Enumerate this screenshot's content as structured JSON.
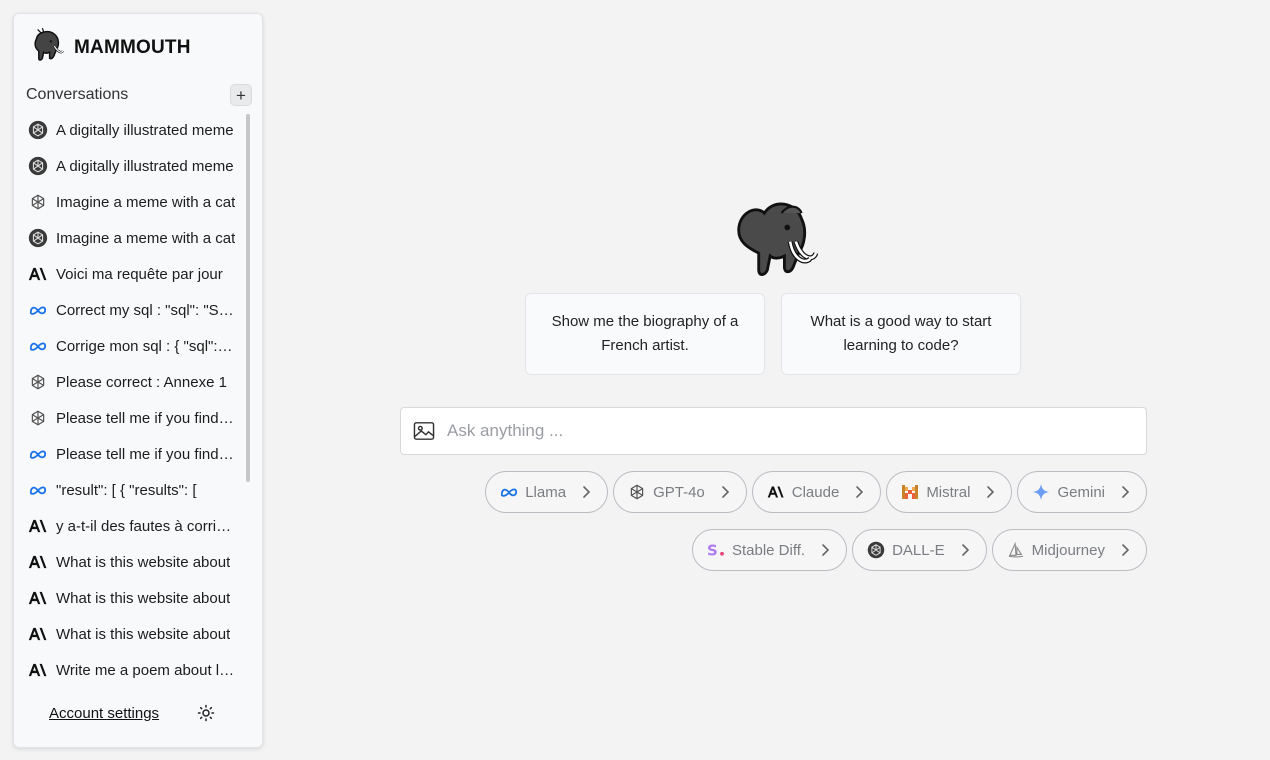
{
  "brand": {
    "name": "MAMMOUTH"
  },
  "sidebar": {
    "conversations_title": "Conversations",
    "new_conversation_label": "+",
    "items": [
      {
        "icon": "openai-dark-icon",
        "label": "A digitally illustrated meme"
      },
      {
        "icon": "openai-dark-icon",
        "label": "A digitally illustrated meme"
      },
      {
        "icon": "openai-icon",
        "label": "Imagine a meme with a cat"
      },
      {
        "icon": "openai-dark-icon",
        "label": "Imagine a meme with a cat"
      },
      {
        "icon": "anthropic-icon",
        "label": "Voici ma requête par jour"
      },
      {
        "icon": "meta-icon",
        "label": "Correct my sql : \"sql\": \"SELECT"
      },
      {
        "icon": "meta-icon",
        "label": "Corrige mon sql : { \"sql\": \"SELECT"
      },
      {
        "icon": "openai-icon",
        "label": "Please correct : Annexe 1"
      },
      {
        "icon": "openai-icon",
        "label": "Please tell me if you find errors"
      },
      {
        "icon": "meta-icon",
        "label": "Please tell me if you find errors"
      },
      {
        "icon": "meta-icon",
        "label": "\"result\": [ { \"results\": ["
      },
      {
        "icon": "anthropic-icon",
        "label": "y a-t-il des fautes à corriger"
      },
      {
        "icon": "anthropic-icon",
        "label": "What is this website about"
      },
      {
        "icon": "anthropic-icon",
        "label": "What is this website about"
      },
      {
        "icon": "anthropic-icon",
        "label": "What is this website about"
      },
      {
        "icon": "anthropic-icon",
        "label": "Write me a poem about love"
      }
    ],
    "account_settings": "Account settings"
  },
  "main": {
    "suggestions": [
      "Show me the biography of a French artist.",
      "What is a good way to start learning to code?"
    ],
    "ask_placeholder": "Ask anything ...",
    "ask_value": "",
    "models_row1": [
      {
        "icon": "meta-icon",
        "label": "Llama"
      },
      {
        "icon": "openai-icon",
        "label": "GPT-4o"
      },
      {
        "icon": "anthropic-icon",
        "label": "Claude"
      },
      {
        "icon": "mistral-icon",
        "label": "Mistral"
      },
      {
        "icon": "gemini-icon",
        "label": "Gemini"
      }
    ],
    "models_row2": [
      {
        "icon": "stability-icon",
        "label": "Stable Diff."
      },
      {
        "icon": "openai-dark-icon",
        "label": "DALL-E"
      },
      {
        "icon": "midjourney-icon",
        "label": "Midjourney"
      }
    ]
  },
  "colors": {
    "background": "#f3f3f3",
    "sidebar_bg": "#f8f9fa",
    "meta_blue": "#1a73e8",
    "gemini_blue": "#6d9ef5",
    "stability_purple": "#b07cf0"
  }
}
